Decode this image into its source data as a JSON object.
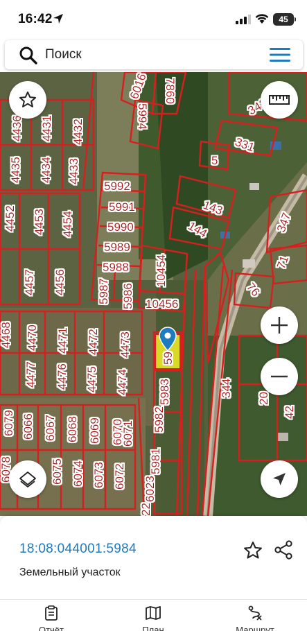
{
  "status_bar": {
    "time": "16:42",
    "battery": "45"
  },
  "search": {
    "placeholder": "Поиск"
  },
  "map": {
    "parcel_labels": {
      "upper_left_grid": [
        "4435",
        "4436",
        "4431",
        "4432",
        "4434",
        "4433"
      ],
      "upper_mid": [
        "5992",
        "5991",
        "5990",
        "5989",
        "5988",
        "5987",
        "5986",
        "10454",
        "10456"
      ],
      "left_mid": [
        "4452",
        "4453",
        "4454",
        "4457",
        "4456"
      ],
      "top_center": [
        "6016",
        "7860",
        "5994"
      ],
      "right_side": [
        "342",
        "331",
        "5",
        "143",
        "144",
        "347",
        "71",
        "76",
        "344",
        "20",
        "42"
      ],
      "lower_left_grid": [
        "4468",
        "4470",
        "4477",
        "4471",
        "4472",
        "4473",
        "4476",
        "4475",
        "4474"
      ],
      "selected_strip": [
        "59",
        "5983",
        "5982",
        "5981",
        "6023",
        "22"
      ],
      "bottom_rows": [
        "6079",
        "6066",
        "6067",
        "6068",
        "6069",
        "6070",
        "6071",
        "6078",
        "6075",
        "6074",
        "6073",
        "6072"
      ]
    },
    "selected_parcel_color": "#f2ef27",
    "boundary_color": "#d81f1f",
    "marker_color": "#1f7bbf"
  },
  "info_sheet": {
    "cadastral_number": "18:08:044001:5984",
    "object_type": "Земельный участок"
  },
  "tabbar": {
    "tabs": [
      {
        "label": "Отчёт",
        "icon": "report-icon"
      },
      {
        "label": "План",
        "icon": "map-plan-icon"
      },
      {
        "label": "Маршрут",
        "icon": "route-icon"
      }
    ]
  }
}
